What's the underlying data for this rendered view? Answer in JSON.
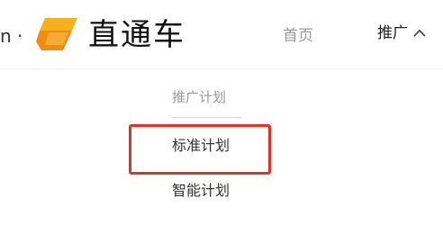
{
  "header": {
    "fragment": "n ·",
    "logo_text": "直通车",
    "logo_icon": "zhitongche-logo-icon",
    "nav": {
      "home_label": "首页",
      "promo_label": "推广",
      "promo_chevron_icon": "chevron-up-icon"
    }
  },
  "dropdown": {
    "header": "推广计划",
    "items": [
      {
        "label": "标准计划"
      },
      {
        "label": "智能计划"
      }
    ]
  },
  "highlight": {
    "color": "#e0322b",
    "target": "标准计划"
  },
  "colors": {
    "logo_orange": "#f7a21b",
    "logo_dark": "#e8870c",
    "muted_text": "#999999"
  }
}
